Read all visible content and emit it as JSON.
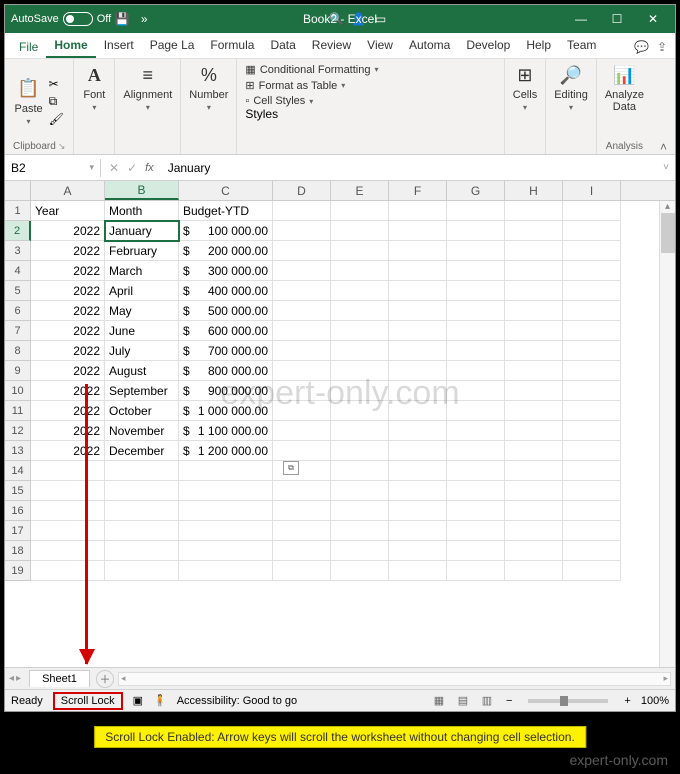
{
  "title": "Book2 - Excel",
  "autosave": {
    "label": "AutoSave",
    "state": "Off"
  },
  "menu": {
    "file": "File",
    "tabs": [
      "Home",
      "Insert",
      "Page La",
      "Formula",
      "Data",
      "Review",
      "View",
      "Automa",
      "Develop",
      "Help",
      "Team"
    ],
    "active": "Home"
  },
  "ribbon": {
    "clipboard": {
      "label": "Clipboard",
      "paste": "Paste"
    },
    "font": {
      "label": "Font"
    },
    "alignment": {
      "label": "Alignment"
    },
    "number": {
      "label": "Number"
    },
    "styles": {
      "label": "Styles",
      "cond_format": "Conditional Formatting",
      "format_table": "Format as Table",
      "cell_styles": "Cell Styles"
    },
    "cells": {
      "label": "Cells"
    },
    "editing": {
      "label": "Editing"
    },
    "analysis": {
      "label": "Analysis",
      "analyze": "Analyze\nData"
    }
  },
  "namebox": "B2",
  "formula": "January",
  "columns": [
    "A",
    "B",
    "C",
    "D",
    "E",
    "F",
    "G",
    "H",
    "I"
  ],
  "active_col": "B",
  "active_row": 2,
  "headers": {
    "A": "Year",
    "B": "Month",
    "C": "Budget-YTD"
  },
  "data_rows": [
    {
      "year": "2022",
      "month": "January",
      "currency": "$",
      "amount": "100 000.00"
    },
    {
      "year": "2022",
      "month": "February",
      "currency": "$",
      "amount": "200 000.00"
    },
    {
      "year": "2022",
      "month": "March",
      "currency": "$",
      "amount": "300 000.00"
    },
    {
      "year": "2022",
      "month": "April",
      "currency": "$",
      "amount": "400 000.00"
    },
    {
      "year": "2022",
      "month": "May",
      "currency": "$",
      "amount": "500 000.00"
    },
    {
      "year": "2022",
      "month": "June",
      "currency": "$",
      "amount": "600 000.00"
    },
    {
      "year": "2022",
      "month": "July",
      "currency": "$",
      "amount": "700 000.00"
    },
    {
      "year": "2022",
      "month": "August",
      "currency": "$",
      "amount": "800 000.00"
    },
    {
      "year": "2022",
      "month": "September",
      "currency": "$",
      "amount": "900 000.00"
    },
    {
      "year": "2022",
      "month": "October",
      "currency": "$",
      "amount": "1 000 000.00"
    },
    {
      "year": "2022",
      "month": "November",
      "currency": "$",
      "amount": "1 100 000.00"
    },
    {
      "year": "2022",
      "month": "December",
      "currency": "$",
      "amount": "1 200 000.00"
    }
  ],
  "total_visible_rows": 19,
  "sheet_tab": "Sheet1",
  "status": {
    "ready": "Ready",
    "scroll_lock": "Scroll Lock",
    "accessibility": "Accessibility: Good to go",
    "zoom": "100%"
  },
  "annotation": "Scroll Lock Enabled: Arrow keys will scroll the worksheet without changing cell selection.",
  "watermark": "expert-only.com"
}
